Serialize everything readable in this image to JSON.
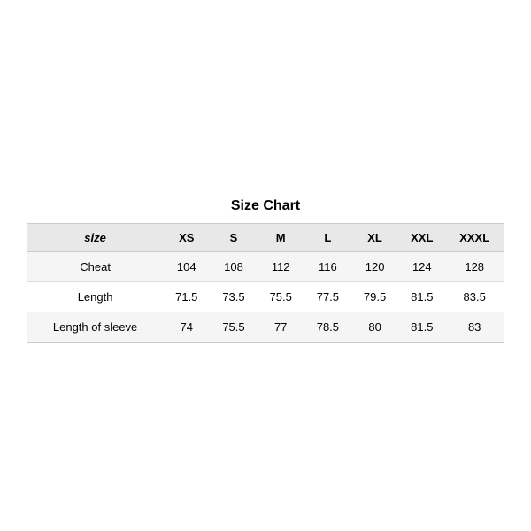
{
  "chart": {
    "title": "Size Chart",
    "columns": [
      "size",
      "XS",
      "S",
      "M",
      "L",
      "XL",
      "XXL",
      "XXXL"
    ],
    "rows": [
      {
        "label": "Cheat",
        "values": [
          "104",
          "108",
          "112",
          "116",
          "120",
          "124",
          "128"
        ]
      },
      {
        "label": "Length",
        "values": [
          "71.5",
          "73.5",
          "75.5",
          "77.5",
          "79.5",
          "81.5",
          "83.5"
        ]
      },
      {
        "label": "Length of sleeve",
        "values": [
          "74",
          "75.5",
          "77",
          "78.5",
          "80",
          "81.5",
          "83"
        ]
      }
    ]
  }
}
